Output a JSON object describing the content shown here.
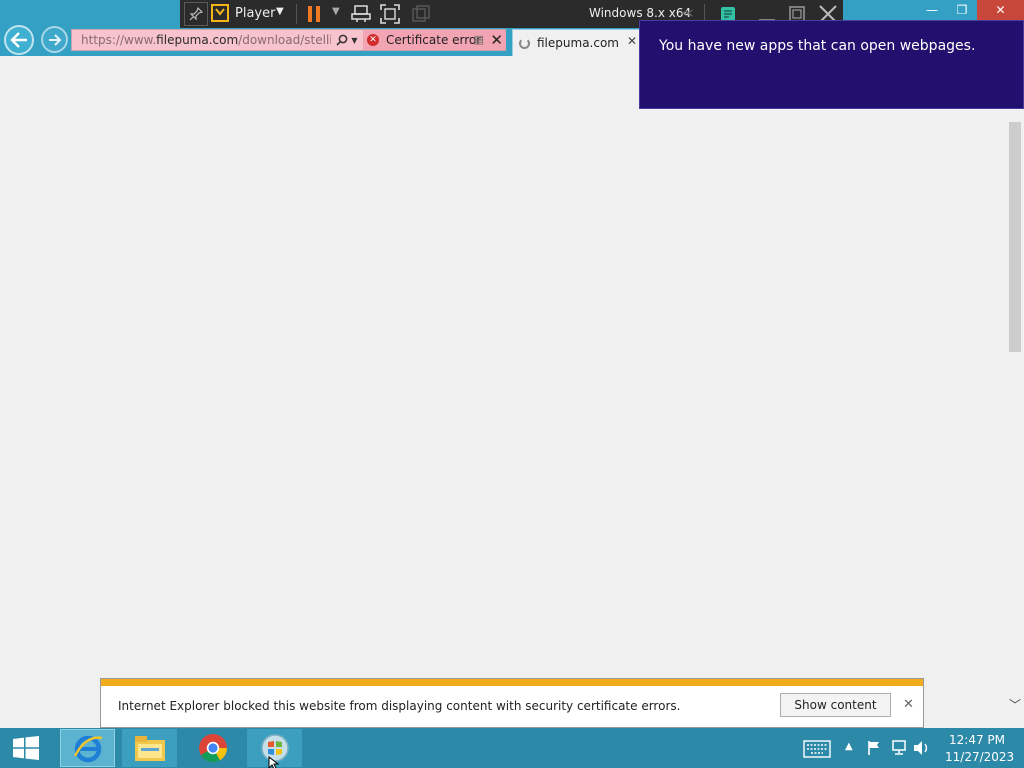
{
  "browser": {
    "address_url_prefix": "https://www.",
    "address_url_host": "filepuma.com",
    "address_url_path": "/download/stelli",
    "cert_error_label": "Certificate error",
    "tabs": [
      {
        "title": "filepuma.com",
        "loading": true
      }
    ]
  },
  "vmware": {
    "menu_label": "Player",
    "vm_title": "Windows 8.x x64"
  },
  "toast": {
    "message": "You have new apps that can open webpages."
  },
  "notification_bar": {
    "message": "Internet Explorer blocked this website from displaying content with security certificate errors.",
    "button_label": "Show content"
  },
  "taskbar": {
    "pinned_apps": [
      "internet-explorer",
      "file-explorer",
      "chrome",
      "installer"
    ],
    "clock_time": "12:47 PM",
    "clock_date": "11/27/2023"
  },
  "colors": {
    "ie_frame": "#34a0c4",
    "cert_error_pink": "#f2a4b2",
    "toast_bg": "#22106e",
    "notification_stripe": "#f2ac1b",
    "taskbar": "#2c89a8"
  }
}
